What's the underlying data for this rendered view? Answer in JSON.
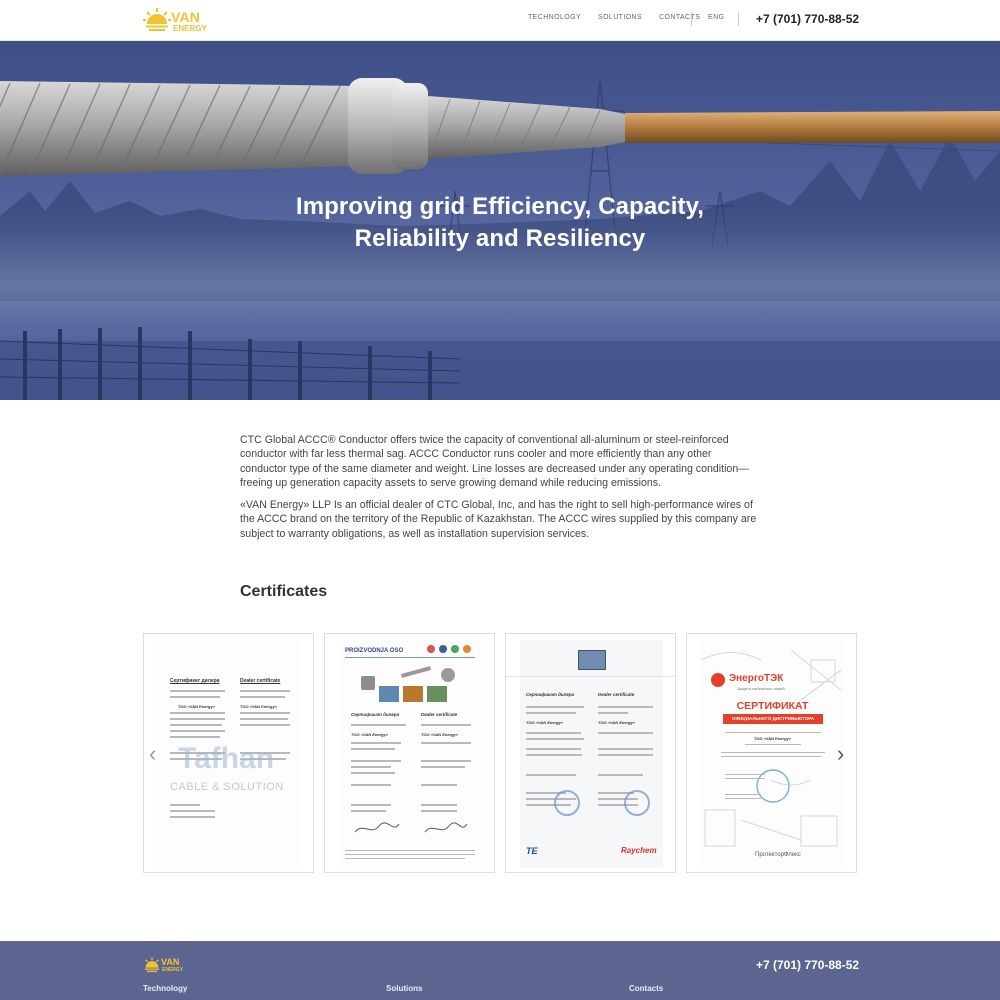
{
  "header": {
    "logo": {
      "brand": "VAN",
      "sub": "ENERGY"
    },
    "nav": [
      "TECHNOLOGY",
      "SOLUTIONS",
      "CONTACTS"
    ],
    "lang": "ENG",
    "phone": "+7 (701) 770-88-52"
  },
  "hero": {
    "title_line1": "Improving grid Efficiency, Capacity,",
    "title_line2": "Reliability and Resiliency"
  },
  "intro": {
    "p1": "CTC Global ACCC® Conductor offers twice the capacity of conventional all-aluminum or steel-reinforced conductor with far less thermal sag. ACCC Conductor runs cooler and more efficiently than any other conductor type of the same diameter and weight. Line losses are decreased under any operating condition—freeing up generation capacity assets to serve growing demand while reducing emissions.",
    "p2": "«VAN Energy» LLP Is an official dealer of CTC Global, Inc, and has the right to sell high-performance wires of the ACCC brand on the territory of the Republic of Kazakhstan. The ACCC wires supplied by this company are subject to warranty obligations, as well as installation supervision services."
  },
  "certificates": {
    "title": "Certificates",
    "items": [
      {
        "heading_ru": "Сертификат дилера",
        "heading_en": "Dealer certificate",
        "company": "ТОО «VAN Energy»",
        "watermark1": "Tafhan",
        "watermark2": "CABLE & SOLUTION"
      },
      {
        "brand": "PROIZVODNJA OSO",
        "heading_ru": "Сертификат дилера",
        "heading_en": "Dealer certificate",
        "company": "ТОО «VAN Energy»"
      },
      {
        "heading_ru": "Сертификат дилера",
        "heading_en": "Dealer certificate",
        "company": "ТОО «VAN Energy»",
        "brand1": "TE",
        "brand2": "Raychem"
      },
      {
        "brand": "ЭнергоТЭК",
        "tagline": "Защита кабельных линий",
        "heading": "СЕРТИФИКАТ",
        "subheading": "ОФИЦИАЛЬНОГО ДИСТРИБЬЮТОРА",
        "company": "ТОО «VAN Energy»",
        "footer_brand": "ПротекторФлекс"
      }
    ]
  },
  "footer": {
    "logo": {
      "brand": "VAN",
      "sub": "ENERGY"
    },
    "phone": "+7 (701) 770-88-52",
    "columns": [
      "Technology",
      "Solutions",
      "Contacts"
    ]
  },
  "colors": {
    "accent": "#f2c230",
    "hero": "#4f5f98",
    "footer": "#5b6590"
  }
}
